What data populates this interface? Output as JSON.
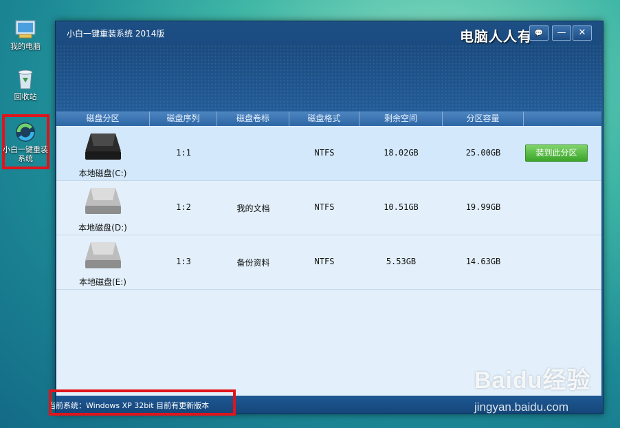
{
  "desktop": {
    "icons": [
      {
        "label": "我的电脑"
      },
      {
        "label": "回收站"
      },
      {
        "label": "小白一键重装系统"
      }
    ]
  },
  "window": {
    "title": "小白一键重装系统 2014版",
    "brand": "电脑人人有",
    "controls": {
      "feedback": "💬",
      "minimize": "—",
      "close": "✕"
    }
  },
  "table": {
    "headers": [
      "磁盘分区",
      "磁盘序列",
      "磁盘卷标",
      "磁盘格式",
      "剩余空间",
      "分区容量"
    ],
    "rows": [
      {
        "drive": "本地磁盘(C:)",
        "seq": "1:1",
        "label": "",
        "format": "NTFS",
        "free": "18.02GB",
        "size": "25.00GB",
        "action": "装到此分区"
      },
      {
        "drive": "本地磁盘(D:)",
        "seq": "1:2",
        "label": "我的文档",
        "format": "NTFS",
        "free": "10.51GB",
        "size": "19.99GB"
      },
      {
        "drive": "本地磁盘(E:)",
        "seq": "1:3",
        "label": "备份资料",
        "format": "NTFS",
        "free": "5.53GB",
        "size": "14.63GB"
      }
    ]
  },
  "status": {
    "text": "当前系统：Windows XP 32bit 目前有更新版本"
  },
  "watermark": {
    "logo": "Baidu经验",
    "url": "jingyan.baidu.com"
  },
  "colors": {
    "accent": "#1f5a92",
    "install_button": "#3aa52a",
    "highlight_box": "#e0141b"
  }
}
